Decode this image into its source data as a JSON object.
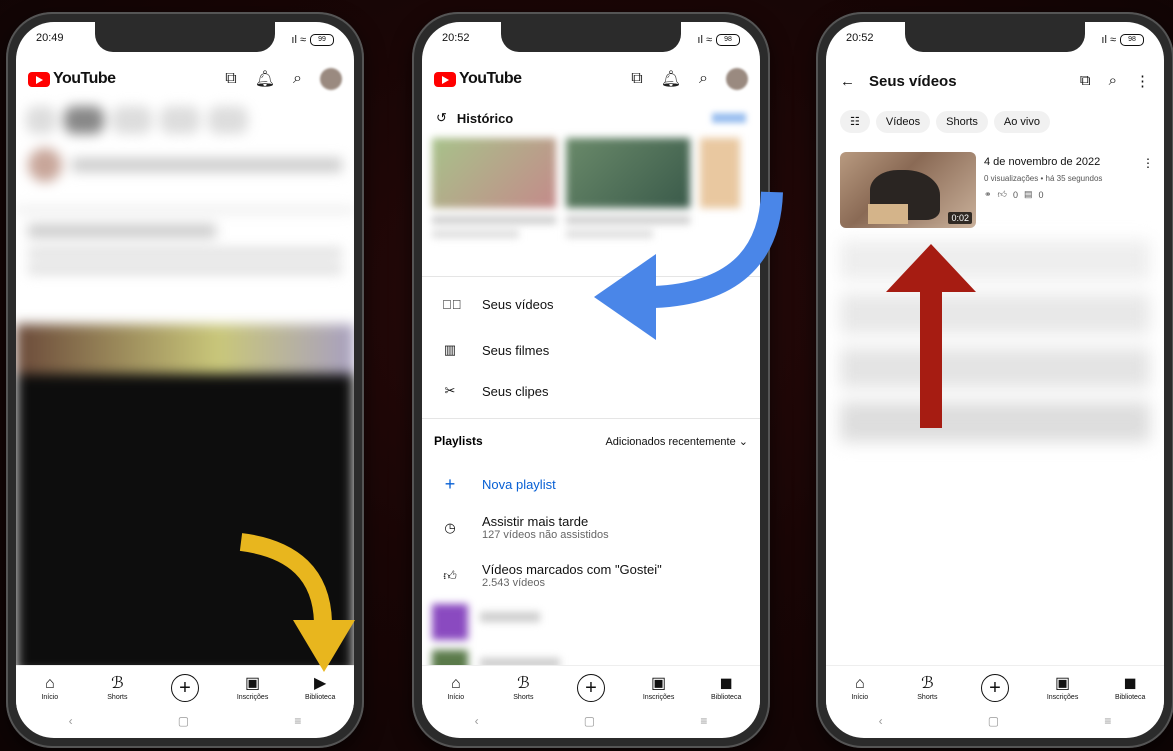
{
  "phone1": {
    "time": "20:49",
    "battery": "99",
    "logo": "YouTube",
    "nav": [
      "Início",
      "Shorts",
      "Inscrições",
      "Biblioteca"
    ]
  },
  "phone2": {
    "time": "20:52",
    "battery": "98",
    "logo": "YouTube",
    "history_title": "Histórico",
    "menu": [
      "Seus vídeos",
      "Seus filmes",
      "Seus clipes"
    ],
    "playlists_title": "Playlists",
    "sort_label": "Adicionados recentemente",
    "new_playlist": "Nova playlist",
    "watch_later": "Assistir mais tarde",
    "watch_later_sub": "127 vídeos não assistidos",
    "liked": "Vídeos marcados com \"Gostei\"",
    "liked_sub": "2.543 vídeos",
    "nav": [
      "Início",
      "Shorts",
      "Inscrições",
      "Biblioteca"
    ]
  },
  "phone3": {
    "time": "20:52",
    "battery": "98",
    "title": "Seus vídeos",
    "chips": [
      "Vídeos",
      "Shorts",
      "Ao vivo"
    ],
    "video_title": "4 de novembro de 2022",
    "video_meta": "0 visualizações • há 35 segundos",
    "likes": "0",
    "comments": "0",
    "duration": "0:02",
    "nav": [
      "Início",
      "Shorts",
      "Inscrições",
      "Biblioteca"
    ]
  },
  "colors": {
    "yellow_arrow": "#E8B61E",
    "blue_arrow": "#4A86E8",
    "red_arrow": "#A61C12",
    "link_blue": "#065FD4"
  }
}
